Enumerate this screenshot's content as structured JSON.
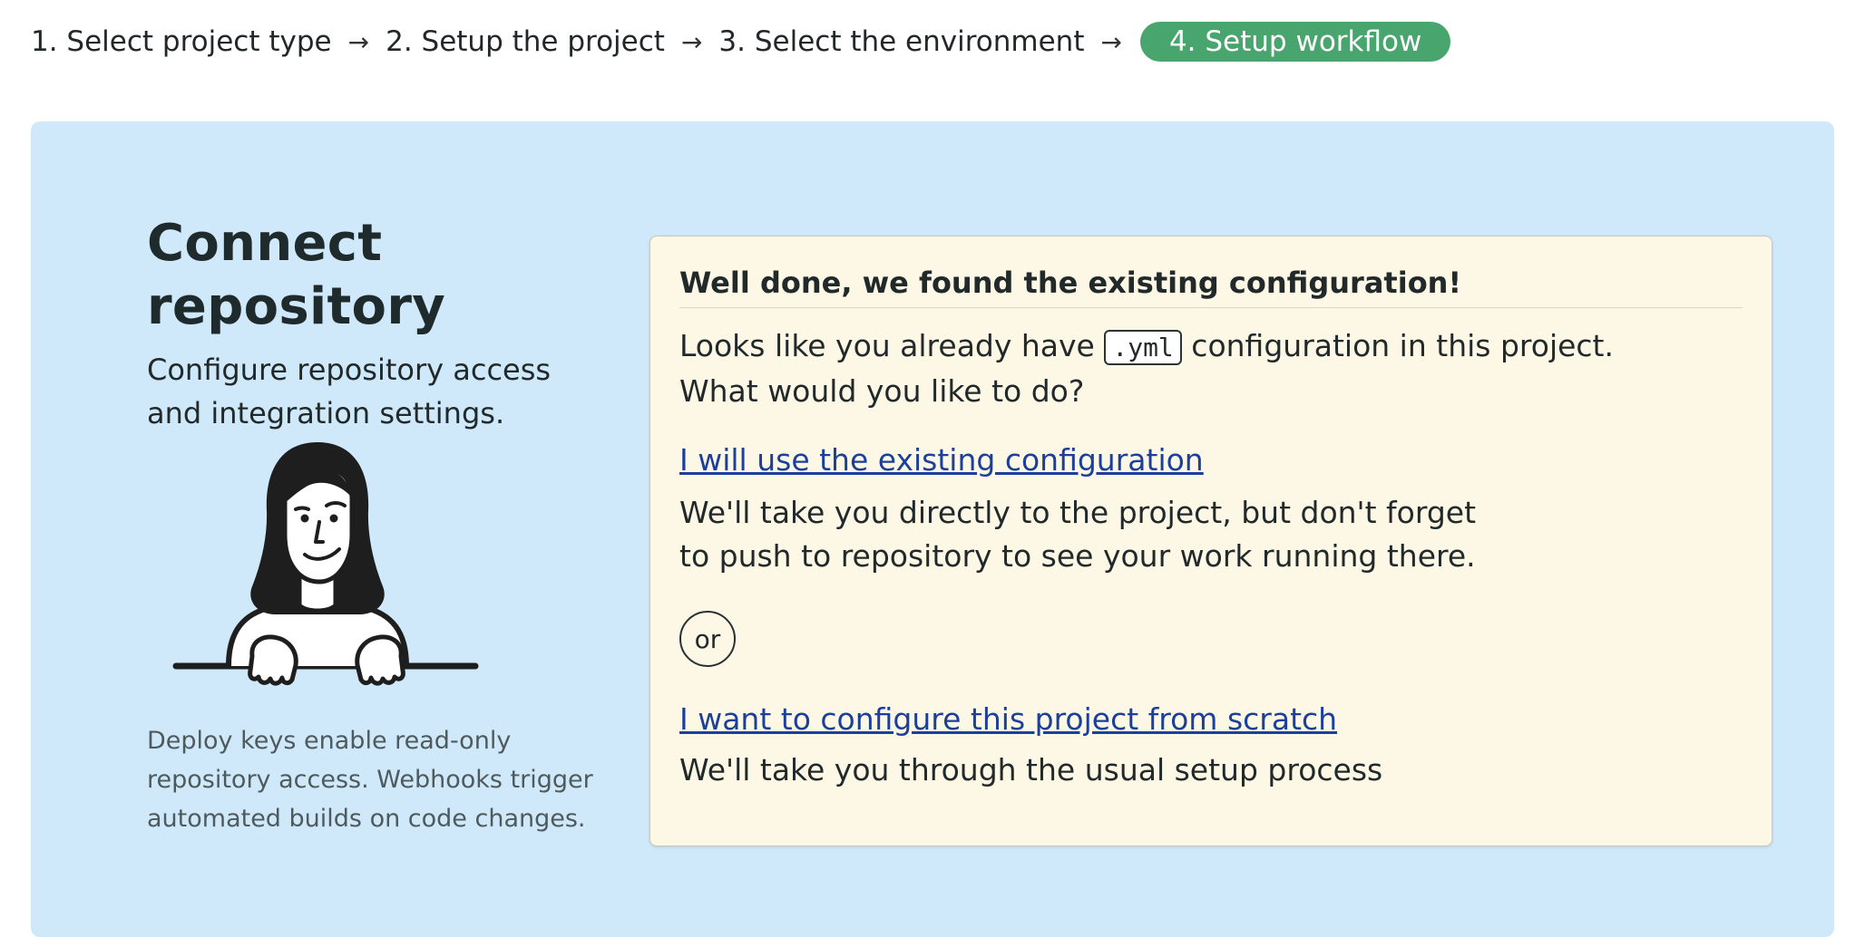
{
  "steps": [
    {
      "label": "1. Select project type"
    },
    {
      "label": "2. Setup the project"
    },
    {
      "label": "3. Select the environment"
    },
    {
      "label": "4. Setup workflow"
    }
  ],
  "step_arrow": "→",
  "active_step": 4,
  "colors": {
    "active_step": "#48a56d",
    "panel_background": "#cfe9fb",
    "card_background": "#fdf8e5",
    "link": "#1b3f9b"
  },
  "left": {
    "title": "Connect repository",
    "subtitle": "Configure repository access and integration settings.",
    "note": "Deploy keys enable read-only repository access. Webhooks trigger automated builds on code changes."
  },
  "card": {
    "title": "Well done, we found the existing configuration!",
    "intro_before": "Looks like you already have",
    "intro_code": ".yml",
    "intro_after": "configuration in this project.",
    "question": "What would you like to do?",
    "option1_link": "I will use the existing configuration",
    "option1_desc": "We'll take you directly to the project, but don't forget to push to repository to see your work running there.",
    "or_label": "or",
    "option2_link": "I want to configure this project from scratch",
    "option2_desc": "We'll take you through the usual setup process"
  }
}
